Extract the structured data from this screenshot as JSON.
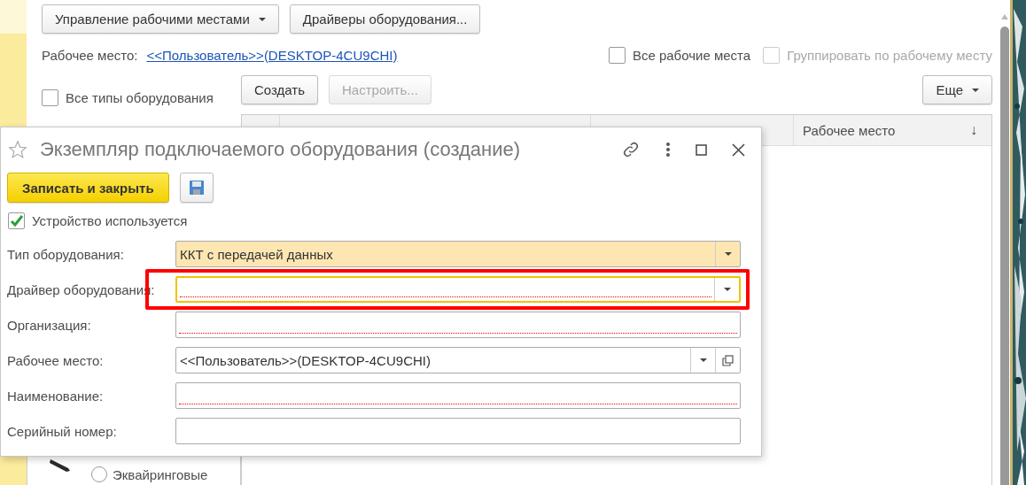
{
  "toolbar": {
    "buttons": [
      {
        "label": "Управление рабочими местами",
        "kind": "menu"
      },
      {
        "label": "Драйверы оборудования...",
        "kind": "plain"
      }
    ]
  },
  "workplace": {
    "label": "Рабочее место:",
    "link": "<<Пользователь>>(DESKTOP-4CU9CHI)"
  },
  "filters": [
    {
      "label": "Все рабочие места",
      "checked": false,
      "disabled": false
    },
    {
      "label": "Группировать по рабочему месту",
      "checked": false,
      "disabled": true
    }
  ],
  "equipment_filter": {
    "label": "Все типы оборудования",
    "checked": false
  },
  "equipment_types": [
    {
      "label": "Эквайринговые",
      "selected": false
    }
  ],
  "list_toolbar": {
    "buttons": [
      {
        "label": "Создать",
        "disabled": false
      },
      {
        "label": "Настроить...",
        "disabled": true
      }
    ],
    "more": "Еще"
  },
  "table": {
    "columns": [
      {
        "label": "Рабочее место",
        "sort_mark": "↓"
      }
    ]
  },
  "dialog": {
    "title": "Экземпляр подключаемого оборудования (создание)",
    "favorite": false,
    "save_close": "Записать и закрыть",
    "in_use": {
      "label": "Устройство используется",
      "checked": true
    },
    "fields": [
      {
        "label": "Тип оборудования:",
        "value": "ККТ с передачей данных",
        "kind": "dropdown",
        "required": false,
        "focused": false,
        "highlighted": true,
        "annotated": false
      },
      {
        "label": "Драйвер оборудования:",
        "kind": "dropdown",
        "required": true,
        "focused": true,
        "highlighted": false,
        "annotated": true
      },
      {
        "label": "Организация:",
        "kind": "text",
        "required": true,
        "focused": false,
        "highlighted": false,
        "annotated": false
      },
      {
        "label": "Рабочее место:",
        "value": "<<Пользователь>>(DESKTOP-4CU9CHI)",
        "kind": "dropdown_open",
        "required": false,
        "focused": false,
        "highlighted": false,
        "annotated": false
      },
      {
        "label": "Наименование:",
        "kind": "text",
        "required": true,
        "focused": false,
        "highlighted": false,
        "annotated": false
      },
      {
        "label": "Серийный номер:",
        "kind": "text",
        "required": false,
        "focused": false,
        "highlighted": false,
        "annotated": false
      }
    ]
  }
}
